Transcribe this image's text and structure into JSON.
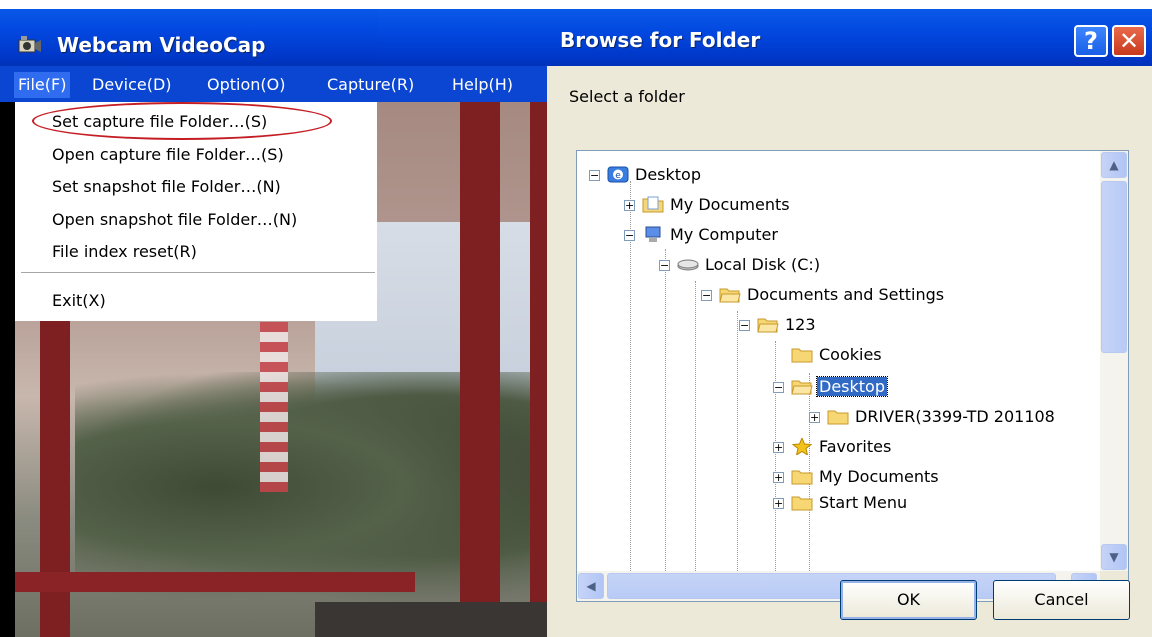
{
  "left_window": {
    "title": "Webcam VideoCap",
    "menu": [
      "File(F)",
      "Device(D)",
      "Option(O)",
      "Capture(R)",
      "Help(H)"
    ],
    "file_menu": {
      "items": [
        "Set capture file Folder…(S)",
        "Open capture file Folder…(S)",
        "Set snapshot file Folder…(N)",
        "Open snapshot file Folder…(N)",
        "File index reset(R)"
      ],
      "exit": "Exit(X)"
    }
  },
  "dialog": {
    "title": "Browse for Folder",
    "help_glyph": "?",
    "close_glyph": "✕",
    "prompt": "Select a folder",
    "tree": [
      "Desktop",
      "My Documents",
      "My Computer",
      "Local Disk (C:)",
      "Documents and Settings",
      "123",
      "Cookies",
      "Desktop",
      "DRIVER(3399-TD 201108",
      "Favorites",
      "My Documents",
      "Start Menu"
    ],
    "selected": "Desktop",
    "ok": "OK",
    "cancel": "Cancel"
  },
  "colors": {
    "titlebar": "#0248e0",
    "selection": "#316ac5",
    "annotation": "#c41e24"
  }
}
